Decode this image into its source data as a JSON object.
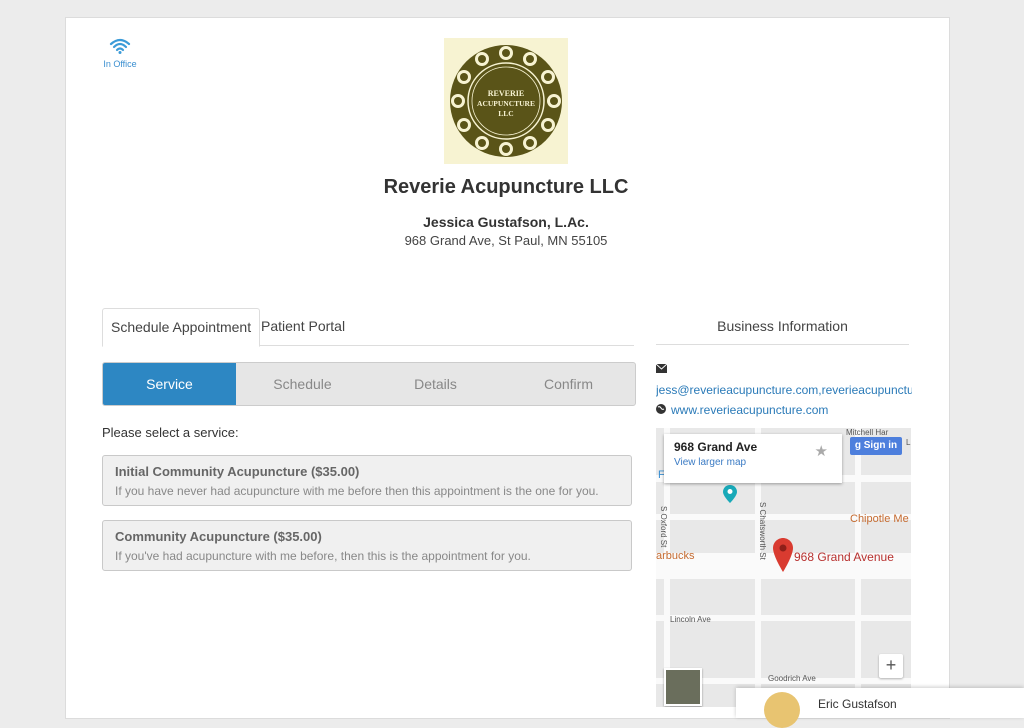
{
  "status": {
    "label": "In Office",
    "icon": "wifi-icon"
  },
  "logo": {
    "line1": "REVERIE",
    "line2": "ACUPUNCTURE",
    "line3": "LLC"
  },
  "business": {
    "name": "Reverie Acupuncture LLC",
    "practitioner": "Jessica Gustafson, L.Ac.",
    "address": "968 Grand Ave, St Paul, MN  55105"
  },
  "tabs": [
    {
      "label": "Schedule Appointment",
      "active": true
    },
    {
      "label": "Patient Portal",
      "active": false
    }
  ],
  "steps": [
    {
      "label": "Service",
      "active": true
    },
    {
      "label": "Schedule",
      "active": false
    },
    {
      "label": "Details",
      "active": false
    },
    {
      "label": "Confirm",
      "active": false
    }
  ],
  "prompt": "Please select a service:",
  "services": [
    {
      "title": "Initial Community Acupuncture ($35.00)",
      "desc": "If you have never had acupuncture with me before then this appointment is the one for you."
    },
    {
      "title": "Community Acupuncture ($35.00)",
      "desc": "If you've had acupuncture with me before, then this is the appointment for you."
    }
  ],
  "info": {
    "heading": "Business Information",
    "email": "jess@reverieacupuncture.com,reverieacupuncture",
    "website": "www.reverieacupuncture.com"
  },
  "map": {
    "card_title": "968 Grand Ave",
    "card_link": "View larger map",
    "signin": "Sign in",
    "marker_label": "968 Grand Avenue",
    "pois": {
      "chipotle": "Chipotle Me",
      "starbucks": "arbucks",
      "mitchell": "Mitchell Har",
      "f": "F",
      "l": "L"
    },
    "streets": {
      "oxford": "S Oxford St",
      "chatsworth": "S Chatsworth St",
      "lincoln": "Lincoln Ave",
      "goodrich": "Goodrich Ave"
    },
    "zoom_in": "+"
  },
  "chat": {
    "name": "Eric Gustafson"
  },
  "colors": {
    "accent": "#2d87c3",
    "link": "#2a7ab8",
    "marker": "#d93b30"
  }
}
